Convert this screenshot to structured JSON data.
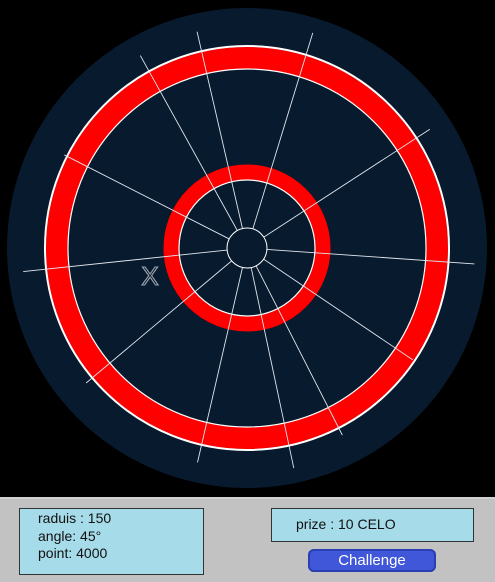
{
  "board": {
    "colors": {
      "background": "#000000",
      "dartboard": "#081a2d",
      "ring": "#ff0000",
      "line": "#ffffff",
      "marker": "#9aa4b0"
    },
    "marker_label": "X",
    "spokes": 12
  },
  "stats": {
    "radius_line": "raduis : 150",
    "angle_line": "angle: 45°",
    "point_line": "point: 4000"
  },
  "prize": {
    "label": "prize : 10 CELO"
  },
  "actions": {
    "challenge_label": "Challenge"
  }
}
